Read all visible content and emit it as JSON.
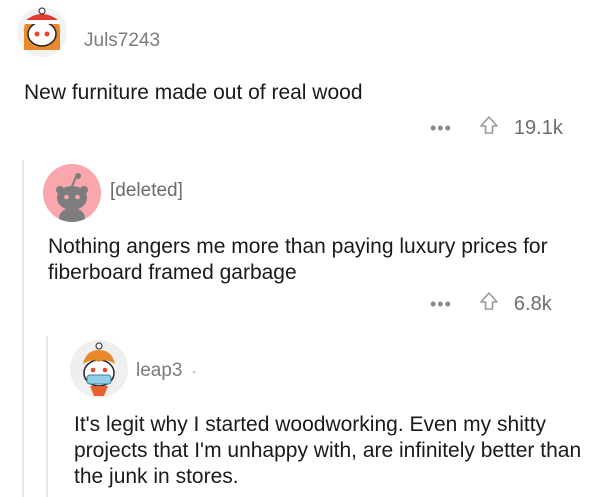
{
  "post": {
    "username": "Juls7243",
    "text": "New furniture made out of real wood",
    "score": "19.1k",
    "more": "•••"
  },
  "reply1": {
    "username": "[deleted]",
    "text": "Nothing angers me more than paying luxury prices for fiberboard framed garbage",
    "score": "6.8k",
    "more": "•••"
  },
  "reply2": {
    "username": "leap3",
    "separator": "·",
    "text": "It's legit why I started woodworking. Even my shitty projects that I'm unhappy with, are infinitely better than the junk in stores."
  },
  "colors": {
    "deleted_avatar_bg": "#f9a7ad",
    "snoo_gray": "#7d7d7d",
    "thread_line": "#e6e6e6"
  }
}
